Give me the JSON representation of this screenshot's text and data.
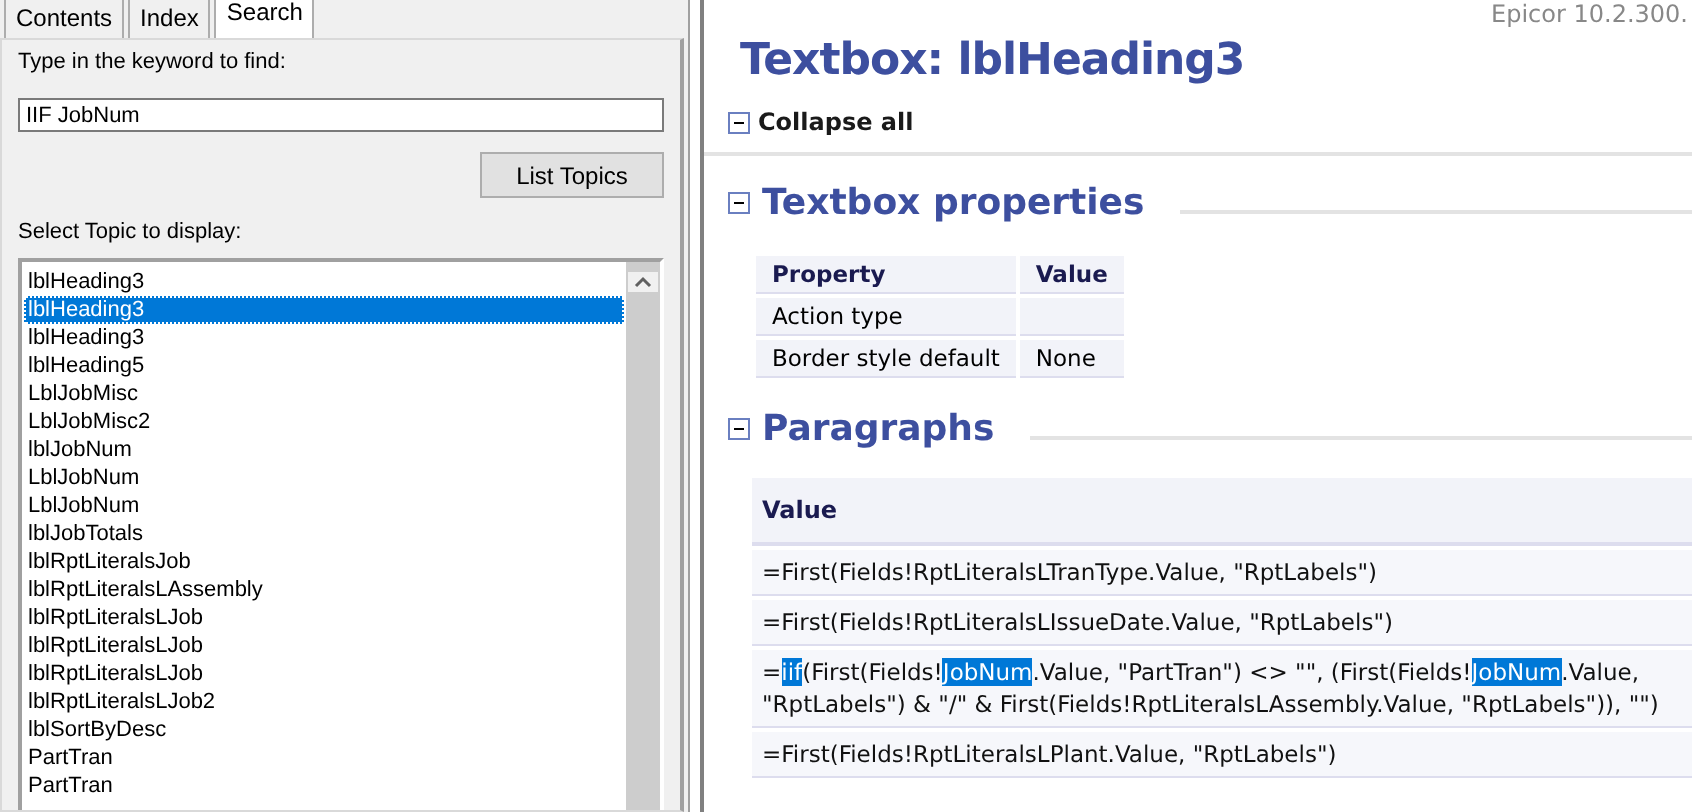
{
  "help_pane": {
    "tabs": [
      {
        "label": "Contents",
        "selected": false
      },
      {
        "label": "Index",
        "selected": false
      },
      {
        "label": "Search",
        "selected": true
      }
    ],
    "keyword_label": "Type in the keyword to find:",
    "keyword": {
      "value": "IIF JobNum"
    },
    "list_button": "List Topics",
    "topic_label": "Select Topic to display:",
    "topics": [
      {
        "label": "lblHeading3",
        "selected": false
      },
      {
        "label": "lblHeading3",
        "selected": true
      },
      {
        "label": "lblHeading3",
        "selected": false
      },
      {
        "label": "lblHeading5",
        "selected": false
      },
      {
        "label": "LblJobMisc",
        "selected": false
      },
      {
        "label": "LblJobMisc2",
        "selected": false
      },
      {
        "label": "lblJobNum",
        "selected": false
      },
      {
        "label": "LblJobNum",
        "selected": false
      },
      {
        "label": "LblJobNum",
        "selected": false
      },
      {
        "label": "lblJobTotals",
        "selected": false
      },
      {
        "label": "lblRptLiteralsJob",
        "selected": false
      },
      {
        "label": "lblRptLiteralsLAssembly",
        "selected": false
      },
      {
        "label": "lblRptLiteralsLJob",
        "selected": false
      },
      {
        "label": "lblRptLiteralsLJob",
        "selected": false
      },
      {
        "label": "lblRptLiteralsLJob",
        "selected": false
      },
      {
        "label": "lblRptLiteralsLJob2",
        "selected": false
      },
      {
        "label": "lblSortByDesc",
        "selected": false
      },
      {
        "label": "PartTran",
        "selected": false
      },
      {
        "label": "PartTran",
        "selected": false
      }
    ]
  },
  "document": {
    "version": "Epicor 10.2.300.",
    "title": "Textbox: lblHeading3",
    "collapse_all": "Collapse all",
    "sections": [
      {
        "kind": "properties",
        "title": "Textbox properties",
        "expanded": true,
        "columns": [
          "Property",
          "Value"
        ],
        "rows": [
          {
            "property": "Action type"
          },
          {
            "property": "Border style default",
            "value": "None"
          }
        ]
      },
      {
        "kind": "values",
        "title": "Paragraphs",
        "expanded": true,
        "columns": [
          "Value"
        ],
        "rows": [
          {
            "segments": [
              {
                "text": "=First(Fields!RptLiteralsLTranType.Value, \"RptLabels\")",
                "highlighted": false
              }
            ]
          },
          {
            "segments": [
              {
                "text": "=First(Fields!RptLiteralsLIssueDate.Value, \"RptLabels\")",
                "highlighted": false
              }
            ]
          },
          {
            "segments": [
              {
                "text": "=",
                "highlighted": false
              },
              {
                "text": "iif",
                "highlighted": true
              },
              {
                "text": "(First(Fields!",
                "highlighted": false
              },
              {
                "text": "JobNum",
                "highlighted": true
              },
              {
                "text": ".Value, \"PartTran\") <> \"\", (First(Fields!",
                "highlighted": false
              },
              {
                "text": "JobNum",
                "highlighted": true
              },
              {
                "text": ".Value, \"RptLabels\") & \"/\" & First(Fields!RptLiteralsLAssembly.Value, \"RptLabels\")), \"\")",
                "highlighted": false
              }
            ]
          },
          {
            "segments": [
              {
                "text": "=First(Fields!RptLiteralsLPlant.Value, \"RptLabels\")",
                "highlighted": false
              }
            ]
          }
        ]
      }
    ]
  }
}
